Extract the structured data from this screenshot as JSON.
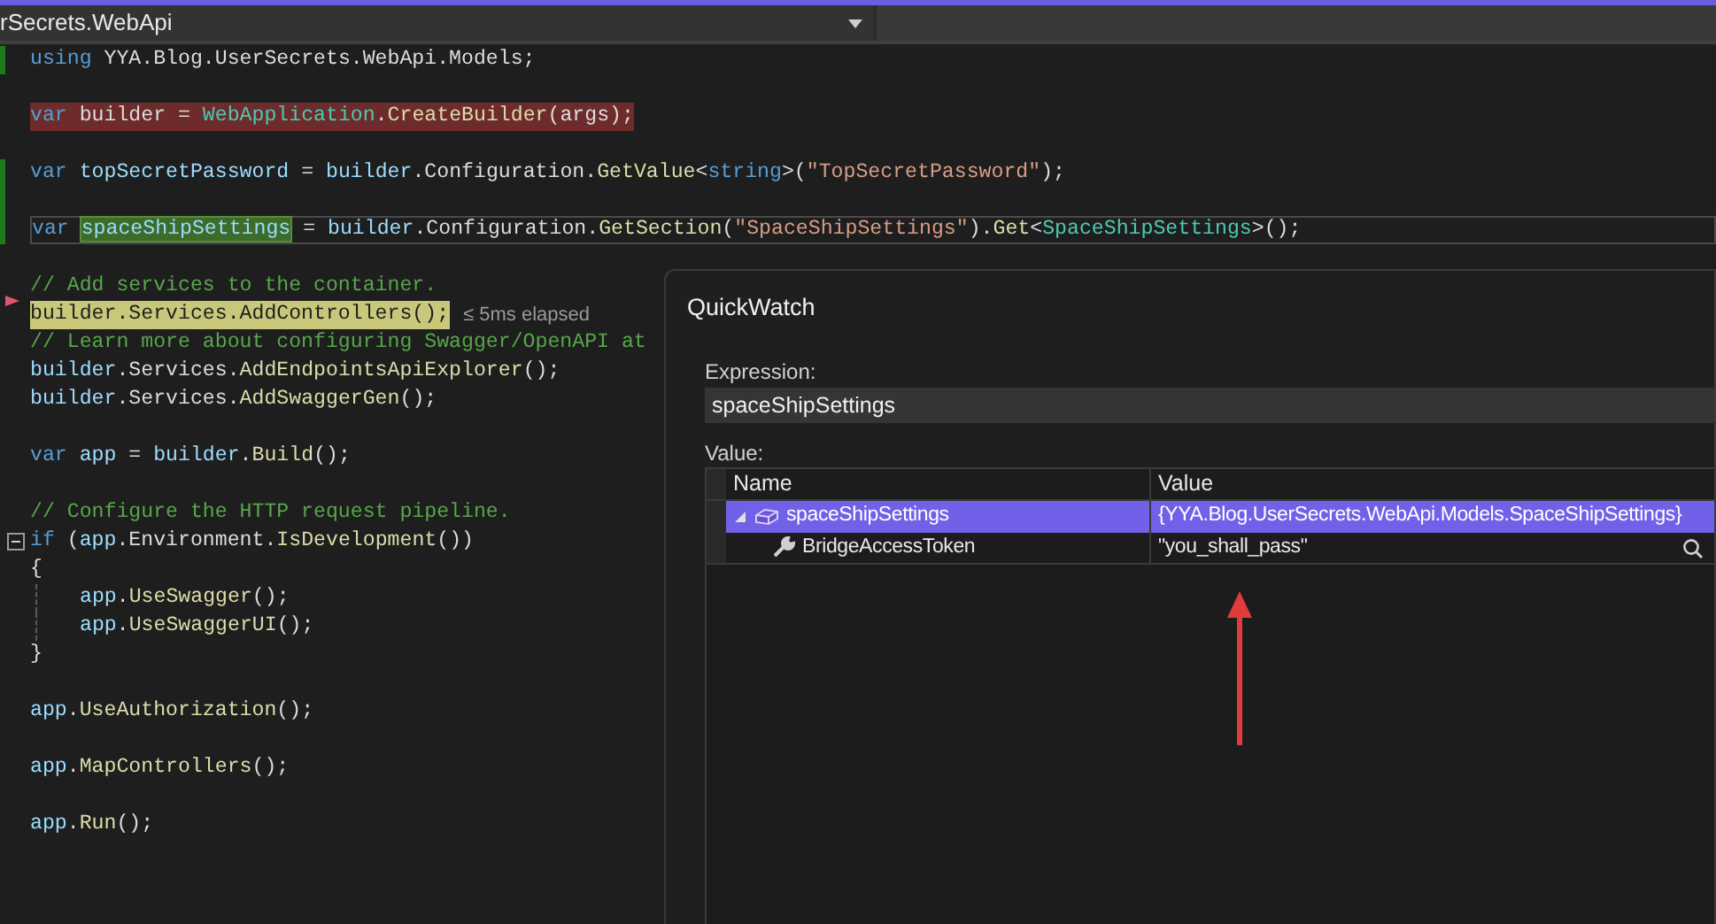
{
  "toolbar": {
    "file_dropdown": "rSecrets.WebApi"
  },
  "editor": {
    "lines": [
      {
        "kind": "code",
        "change_bar": true,
        "tokens": [
          {
            "text": "using ",
            "kind": "keyword"
          },
          {
            "text": "YYA.Blog.UserSecrets.WebApi.Models;",
            "kind": "plain"
          }
        ]
      },
      {
        "kind": "blank",
        "change_bar": false
      },
      {
        "kind": "breakpoint",
        "change_bar": false,
        "tokens": [
          {
            "text": "var ",
            "kind": "keyword"
          },
          {
            "text": "builder = ",
            "kind": "plain"
          },
          {
            "text": "WebApplication",
            "kind": "type"
          },
          {
            "text": ".",
            "kind": "plain"
          },
          {
            "text": "CreateBuilder",
            "kind": "method"
          },
          {
            "text": "(args);",
            "kind": "plain"
          }
        ]
      },
      {
        "kind": "blank",
        "change_bar": false
      },
      {
        "kind": "code",
        "change_bar": true,
        "tokens": [
          {
            "text": "var ",
            "kind": "keyword"
          },
          {
            "text": "topSecretPassword",
            "kind": "variable"
          },
          {
            "text": " = ",
            "kind": "plain"
          },
          {
            "text": "builder",
            "kind": "variable"
          },
          {
            "text": ".Configuration.",
            "kind": "plain"
          },
          {
            "text": "GetValue",
            "kind": "method"
          },
          {
            "text": "<",
            "kind": "plain"
          },
          {
            "text": "string",
            "kind": "keyword"
          },
          {
            "text": ">(",
            "kind": "plain"
          },
          {
            "text": "\"TopSecretPassword\"",
            "kind": "string"
          },
          {
            "text": ");",
            "kind": "plain"
          }
        ]
      },
      {
        "kind": "blank",
        "change_bar": true
      },
      {
        "kind": "caret-line",
        "change_bar": true,
        "tokens": [
          {
            "text": "var ",
            "kind": "keyword"
          },
          {
            "text": "spaceShipSettings",
            "kind": "selection"
          },
          {
            "text": " = ",
            "kind": "plain"
          },
          {
            "text": "builder",
            "kind": "variable"
          },
          {
            "text": ".Configuration.",
            "kind": "plain"
          },
          {
            "text": "GetSection",
            "kind": "method"
          },
          {
            "text": "(",
            "kind": "plain"
          },
          {
            "text": "\"SpaceShipSettings\"",
            "kind": "string"
          },
          {
            "text": ").",
            "kind": "plain"
          },
          {
            "text": "Get",
            "kind": "method"
          },
          {
            "text": "<",
            "kind": "plain"
          },
          {
            "text": "SpaceShipSettings",
            "kind": "type"
          },
          {
            "text": ">();",
            "kind": "plain"
          }
        ]
      },
      {
        "kind": "blank",
        "change_bar": false
      },
      {
        "kind": "code",
        "change_bar": false,
        "tokens": [
          {
            "text": "// Add services to the container.",
            "kind": "comment"
          }
        ]
      },
      {
        "kind": "current",
        "change_bar": false,
        "hint": "≤ 5ms elapsed",
        "tokens": [
          {
            "text": "builder.Services.AddControllers();",
            "kind": "plain"
          }
        ]
      },
      {
        "kind": "code",
        "change_bar": false,
        "tokens": [
          {
            "text": "// Learn more about configuring Swagger/OpenAPI at",
            "kind": "comment"
          }
        ]
      },
      {
        "kind": "code",
        "change_bar": false,
        "tokens": [
          {
            "text": "builder",
            "kind": "variable"
          },
          {
            "text": ".Services.",
            "kind": "plain"
          },
          {
            "text": "AddEndpointsApiExplorer",
            "kind": "method"
          },
          {
            "text": "();",
            "kind": "plain"
          }
        ]
      },
      {
        "kind": "code",
        "change_bar": false,
        "tokens": [
          {
            "text": "builder",
            "kind": "variable"
          },
          {
            "text": ".Services.",
            "kind": "plain"
          },
          {
            "text": "AddSwaggerGen",
            "kind": "method"
          },
          {
            "text": "();",
            "kind": "plain"
          }
        ]
      },
      {
        "kind": "blank",
        "change_bar": false
      },
      {
        "kind": "code",
        "change_bar": false,
        "tokens": [
          {
            "text": "var ",
            "kind": "keyword"
          },
          {
            "text": "app",
            "kind": "variable"
          },
          {
            "text": " = ",
            "kind": "plain"
          },
          {
            "text": "builder",
            "kind": "variable"
          },
          {
            "text": ".",
            "kind": "plain"
          },
          {
            "text": "Build",
            "kind": "method"
          },
          {
            "text": "();",
            "kind": "plain"
          }
        ]
      },
      {
        "kind": "blank",
        "change_bar": false
      },
      {
        "kind": "code",
        "change_bar": false,
        "tokens": [
          {
            "text": "// Configure the HTTP request pipeline.",
            "kind": "comment"
          }
        ]
      },
      {
        "kind": "fold",
        "change_bar": false,
        "tokens": [
          {
            "text": "if",
            "kind": "keyword"
          },
          {
            "text": " (",
            "kind": "plain"
          },
          {
            "text": "app",
            "kind": "variable"
          },
          {
            "text": ".Environment.",
            "kind": "plain"
          },
          {
            "text": "IsDevelopment",
            "kind": "method"
          },
          {
            "text": "())",
            "kind": "plain"
          }
        ]
      },
      {
        "kind": "code",
        "change_bar": false,
        "tokens": [
          {
            "text": "{",
            "kind": "plain"
          }
        ]
      },
      {
        "kind": "indented",
        "change_bar": false,
        "tokens": [
          {
            "text": "app",
            "kind": "variable"
          },
          {
            "text": ".",
            "kind": "plain"
          },
          {
            "text": "UseSwagger",
            "kind": "method"
          },
          {
            "text": "();",
            "kind": "plain"
          }
        ]
      },
      {
        "kind": "indented",
        "change_bar": false,
        "tokens": [
          {
            "text": "app",
            "kind": "variable"
          },
          {
            "text": ".",
            "kind": "plain"
          },
          {
            "text": "UseSwaggerUI",
            "kind": "method"
          },
          {
            "text": "();",
            "kind": "plain"
          }
        ]
      },
      {
        "kind": "code",
        "change_bar": false,
        "tokens": [
          {
            "text": "}",
            "kind": "plain"
          }
        ]
      },
      {
        "kind": "blank",
        "change_bar": false
      },
      {
        "kind": "code",
        "change_bar": false,
        "tokens": [
          {
            "text": "app",
            "kind": "variable"
          },
          {
            "text": ".",
            "kind": "plain"
          },
          {
            "text": "UseAuthorization",
            "kind": "method"
          },
          {
            "text": "();",
            "kind": "plain"
          }
        ]
      },
      {
        "kind": "blank",
        "change_bar": false
      },
      {
        "kind": "code",
        "change_bar": false,
        "tokens": [
          {
            "text": "app",
            "kind": "variable"
          },
          {
            "text": ".",
            "kind": "plain"
          },
          {
            "text": "MapControllers",
            "kind": "method"
          },
          {
            "text": "();",
            "kind": "plain"
          }
        ]
      },
      {
        "kind": "blank",
        "change_bar": false
      },
      {
        "kind": "code",
        "change_bar": false,
        "tokens": [
          {
            "text": "app",
            "kind": "variable"
          },
          {
            "text": ".",
            "kind": "plain"
          },
          {
            "text": "Run",
            "kind": "method"
          },
          {
            "text": "();",
            "kind": "plain"
          }
        ]
      }
    ]
  },
  "quickwatch": {
    "title": "QuickWatch",
    "expression_label": "Expression:",
    "expression": "spaceShipSettings",
    "value_label": "Value:",
    "columns": [
      "Name",
      "Value"
    ],
    "rows": [
      {
        "name": "spaceShipSettings",
        "value": "{YYA.Blog.UserSecrets.WebApi.Models.SpaceShipSettings}",
        "expanded": true,
        "selected": true,
        "children": [
          {
            "name": "BridgeAccessToken",
            "value": "\"you_shall_pass\"",
            "selected": false
          }
        ]
      }
    ]
  }
}
